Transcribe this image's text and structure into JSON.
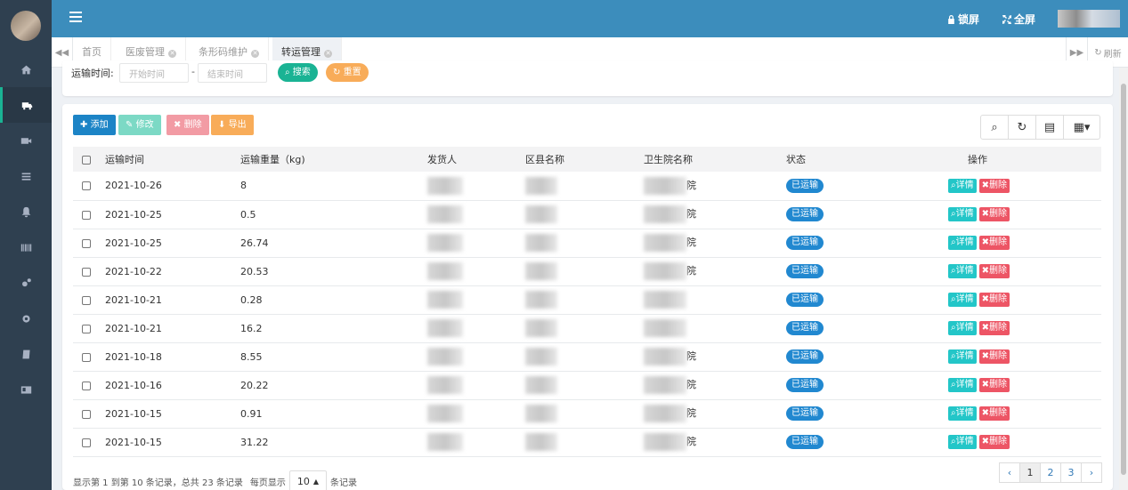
{
  "header": {
    "lock_label": "锁屏",
    "fullscreen_label": "全屏"
  },
  "tabs": [
    {
      "label": "首页",
      "closable": false,
      "active": false
    },
    {
      "label": "医废管理",
      "closable": true,
      "active": false
    },
    {
      "label": "条形码维护",
      "closable": true,
      "active": false
    },
    {
      "label": "转运管理",
      "closable": true,
      "active": true
    }
  ],
  "tab_refresh_label": "刷新",
  "search": {
    "label": "运输时间:",
    "start_placeholder": "开始时间",
    "end_placeholder": "结束时间",
    "separator": "-",
    "search_label": "搜索",
    "reset_label": "重置"
  },
  "toolbar": {
    "add_label": "添加",
    "edit_label": "修改",
    "delete_label": "删除",
    "export_label": "导出"
  },
  "table": {
    "columns": [
      "运输时间",
      "运输重量（kg)",
      "发货人",
      "区县名称",
      "卫生院名称",
      "状态",
      "操作"
    ],
    "rows": [
      {
        "date": "2021-10-26",
        "weight": "8",
        "hospital_suffix": "院",
        "status": "已运输"
      },
      {
        "date": "2021-10-25",
        "weight": "0.5",
        "hospital_suffix": "院",
        "status": "已运输"
      },
      {
        "date": "2021-10-25",
        "weight": "26.74",
        "hospital_suffix": "院",
        "status": "已运输"
      },
      {
        "date": "2021-10-22",
        "weight": "20.53",
        "hospital_suffix": "院",
        "status": "已运输"
      },
      {
        "date": "2021-10-21",
        "weight": "0.28",
        "hospital_suffix": "",
        "status": "已运输"
      },
      {
        "date": "2021-10-21",
        "weight": "16.2",
        "hospital_suffix": "",
        "status": "已运输"
      },
      {
        "date": "2021-10-18",
        "weight": "8.55",
        "hospital_suffix": "院",
        "status": "已运输"
      },
      {
        "date": "2021-10-16",
        "weight": "20.22",
        "hospital_suffix": "院",
        "status": "已运输"
      },
      {
        "date": "2021-10-15",
        "weight": "0.91",
        "hospital_suffix": "院",
        "status": "已运输"
      },
      {
        "date": "2021-10-15",
        "weight": "31.22",
        "hospital_suffix": "院",
        "status": "已运输"
      }
    ],
    "detail_label": "详情",
    "delete_label": "删除"
  },
  "footer": {
    "summary": "显示第 1 到第 10 条记录，总共 23 条记录",
    "per_page_prefix": "每页显示",
    "page_size": "10",
    "per_page_suffix": "条记录"
  },
  "pager": {
    "prev": "‹",
    "pages": [
      "1",
      "2",
      "3"
    ],
    "next": "›"
  },
  "colors": {
    "sidebar": "#2f4050",
    "header": "#3c8dbc",
    "primary": "#1c84c6",
    "status_badge": "#2188d0",
    "detail": "#23c6c8",
    "danger": "#ed5565",
    "search_btn": "#1ab394",
    "reset_btn": "#f8ac59"
  }
}
